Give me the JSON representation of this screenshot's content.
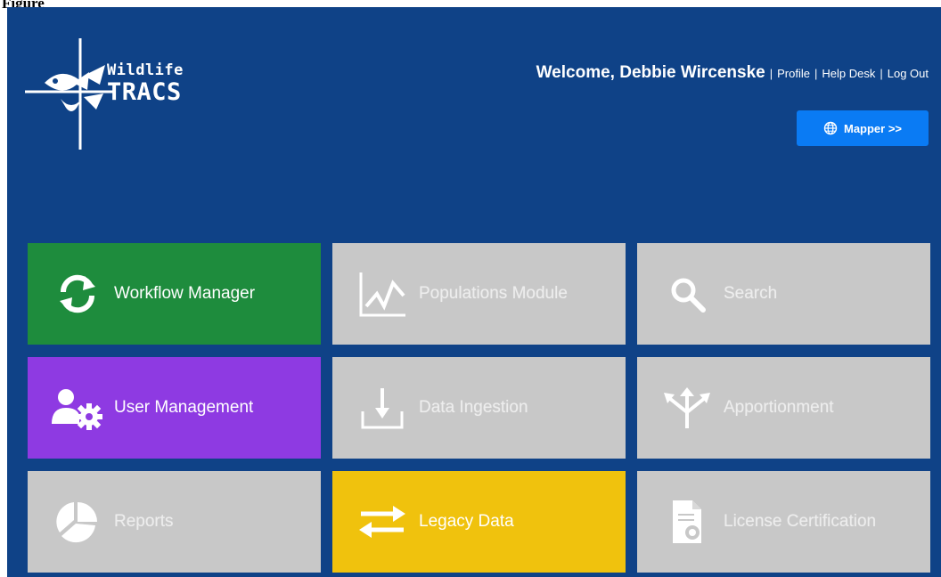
{
  "page_label": "Figure",
  "header": {
    "logo_line1": "Wildlife",
    "logo_line2": "TRACS",
    "welcome": "Welcome, Debbie Wircenske",
    "separator": "|",
    "links": {
      "profile": "Profile",
      "help_desk": "Help Desk",
      "log_out": "Log Out"
    },
    "mapper_button": "Mapper >>"
  },
  "tiles": [
    {
      "label": "Workflow Manager",
      "icon": "refresh-icon",
      "state": "enabled",
      "color": "#1e8c3d"
    },
    {
      "label": "Populations Module",
      "icon": "line-chart-icon",
      "state": "disabled",
      "color": "#c8c8c8"
    },
    {
      "label": "Search",
      "icon": "magnifier-icon",
      "state": "disabled",
      "color": "#c8c8c8"
    },
    {
      "label": "User Management",
      "icon": "user-gear-icon",
      "state": "enabled",
      "color": "#8e3ae2"
    },
    {
      "label": "Data Ingestion",
      "icon": "download-tray-icon",
      "state": "disabled",
      "color": "#c8c8c8"
    },
    {
      "label": "Apportionment",
      "icon": "split-arrows-icon",
      "state": "disabled",
      "color": "#c8c8c8"
    },
    {
      "label": "Reports",
      "icon": "pie-chart-icon",
      "state": "disabled",
      "color": "#c8c8c8"
    },
    {
      "label": "Legacy Data",
      "icon": "swap-arrows-icon",
      "state": "enabled",
      "color": "#f0c20d"
    },
    {
      "label": "License Certification",
      "icon": "certificate-document-icon",
      "state": "disabled",
      "color": "#c8c8c8"
    }
  ],
  "colors": {
    "header_bg": "#0f4287",
    "mapper_bg": "#0a7bf4"
  }
}
